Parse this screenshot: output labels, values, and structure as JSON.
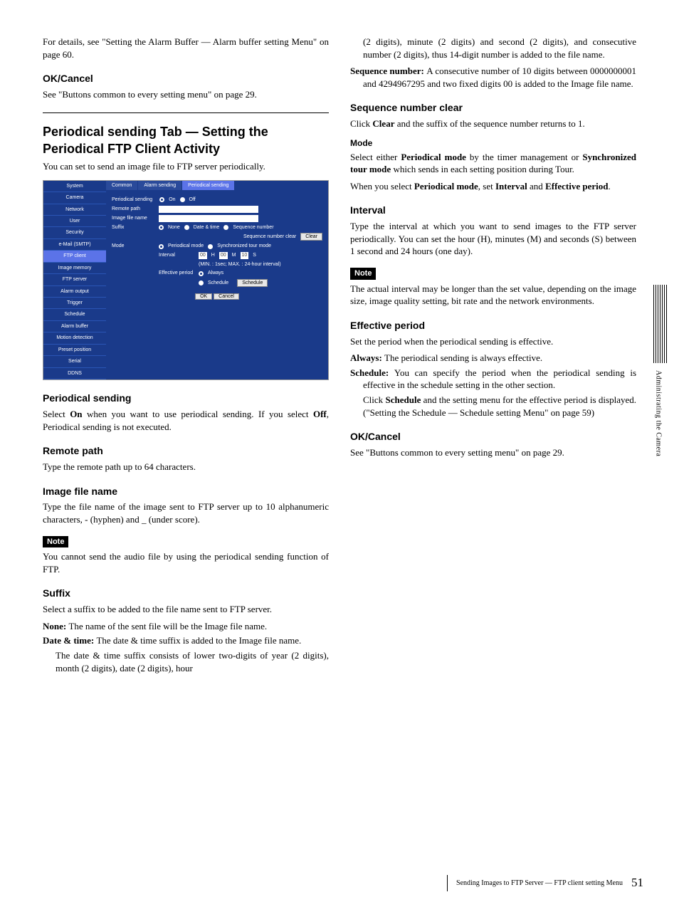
{
  "left": {
    "p0": "For details, see \"Setting the Alarm Buffer — Alarm buffer setting Menu\" on page 60.",
    "okcancel_h": "OK/Cancel",
    "okcancel_p": "See \"Buttons common to every setting menu\" on page 29.",
    "sect_h": "Periodical sending Tab — Setting the Periodical FTP Client Activity",
    "sect_p": "You can set to send an image file to FTP server periodically.",
    "ps_h": "Periodical sending",
    "ps_p": "Select On when you want to use periodical sending. If you select Off, Periodical sending is not executed.",
    "rp_h": "Remote path",
    "rp_p": "Type the remote path up to 64 characters.",
    "ifn_h": "Image file name",
    "ifn_p": "Type the file name of the image sent to FTP server up to 10 alphanumeric characters, - (hyphen) and _ (under score).",
    "note_label": "Note",
    "ifn_note": "You cannot send the audio file by using the periodical sending function of FTP.",
    "suf_h": "Suffix",
    "suf_p": "Select a suffix to be added to the file name sent to FTP server.",
    "suf_none_t": "None: ",
    "suf_none": "The name of the sent file will be the Image file name.",
    "suf_dt_t": "Date & time: ",
    "suf_dt": "The date & time suffix is added to the Image file name.",
    "suf_dt2": "The date & time suffix consists of lower two-digits of year (2 digits), month (2 digits), date (2 digits), hour"
  },
  "right": {
    "suf_dt3": "(2 digits), minute (2 digits) and second (2 digits), and consecutive number (2 digits), thus 14-digit number is added to the file name.",
    "seqnum_t": "Sequence number: ",
    "seqnum": "A consecutive number of 10 digits between 0000000001 and 4294967295 and two fixed digits 00 is added to the Image file name.",
    "snc_h": "Sequence number clear",
    "snc_p": "Click Clear and the suffix of the sequence number returns to 1.",
    "mode_h": "Mode",
    "mode_p1": "Select either Periodical mode by the timer management or Synchronized tour mode which sends in each setting position during Tour.",
    "mode_p2": "When you select Periodical mode, set Interval and Effective period.",
    "int_h": "Interval",
    "int_p": "Type the interval at which you want to send images to the FTP server periodically. You can set the hour (H), minutes (M) and seconds (S) between 1 second and 24 hours (one day).",
    "note_label": "Note",
    "int_note": "The actual interval may be longer than the set value, depending on the image size, image quality setting, bit rate and the network environments.",
    "ep_h": "Effective period",
    "ep_p": "Set the period when the periodical sending is effective.",
    "ep_always_t": "Always: ",
    "ep_always": "The periodical sending is always effective.",
    "ep_sched_t": "Schedule: ",
    "ep_sched": "You can specify the period when the periodical sending is effective in the schedule setting in the other section.",
    "ep_sched2": "Click Schedule and the setting menu for the effective period is displayed. (\"Setting the Schedule — Schedule setting Menu\" on page 59)",
    "okcancel_h": "OK/Cancel",
    "okcancel_p": "See \"Buttons common to every setting menu\" on page 29."
  },
  "figure": {
    "menu": [
      "System",
      "Camera",
      "Network",
      "User",
      "Security",
      "e-Mail (SMTP)",
      "FTP client",
      "Image memory",
      "FTP server",
      "Alarm output",
      "Trigger",
      "Schedule",
      "Alarm buffer",
      "Motion detection",
      "Preset position",
      "Serial",
      "DDNS"
    ],
    "menu_sel": 6,
    "tabs": [
      "Common",
      "Alarm sending",
      "Periodical sending"
    ],
    "tab_active": 2,
    "labels": {
      "ps": "Periodical sending",
      "rp": "Remote path",
      "ifn": "Image file name",
      "suf": "Suffix",
      "snc": "Sequence number clear",
      "mode": "Mode",
      "int": "Interval",
      "inthint": "(MIN. : 1sec; MAX. : 24-hour interval)",
      "ep": "Effective period"
    },
    "opts": {
      "on": "On",
      "off": "Off",
      "none": "None",
      "dt": "Date & time",
      "sn": "Sequence number",
      "pm": "Periodical mode",
      "stm": "Synchronized tour mode",
      "always": "Always",
      "sched": "Schedule"
    },
    "int_vals": {
      "h": "00",
      "m": "00",
      "s": "10",
      "hl": "H",
      "ml": "M",
      "sl": "S"
    },
    "buttons": {
      "clear": "Clear",
      "ok": "OK",
      "cancel": "Cancel",
      "sched": "Schedule"
    }
  },
  "side": "Administrating the Camera",
  "footer": "Sending Images to FTP Server — FTP client setting Menu",
  "page": "51"
}
